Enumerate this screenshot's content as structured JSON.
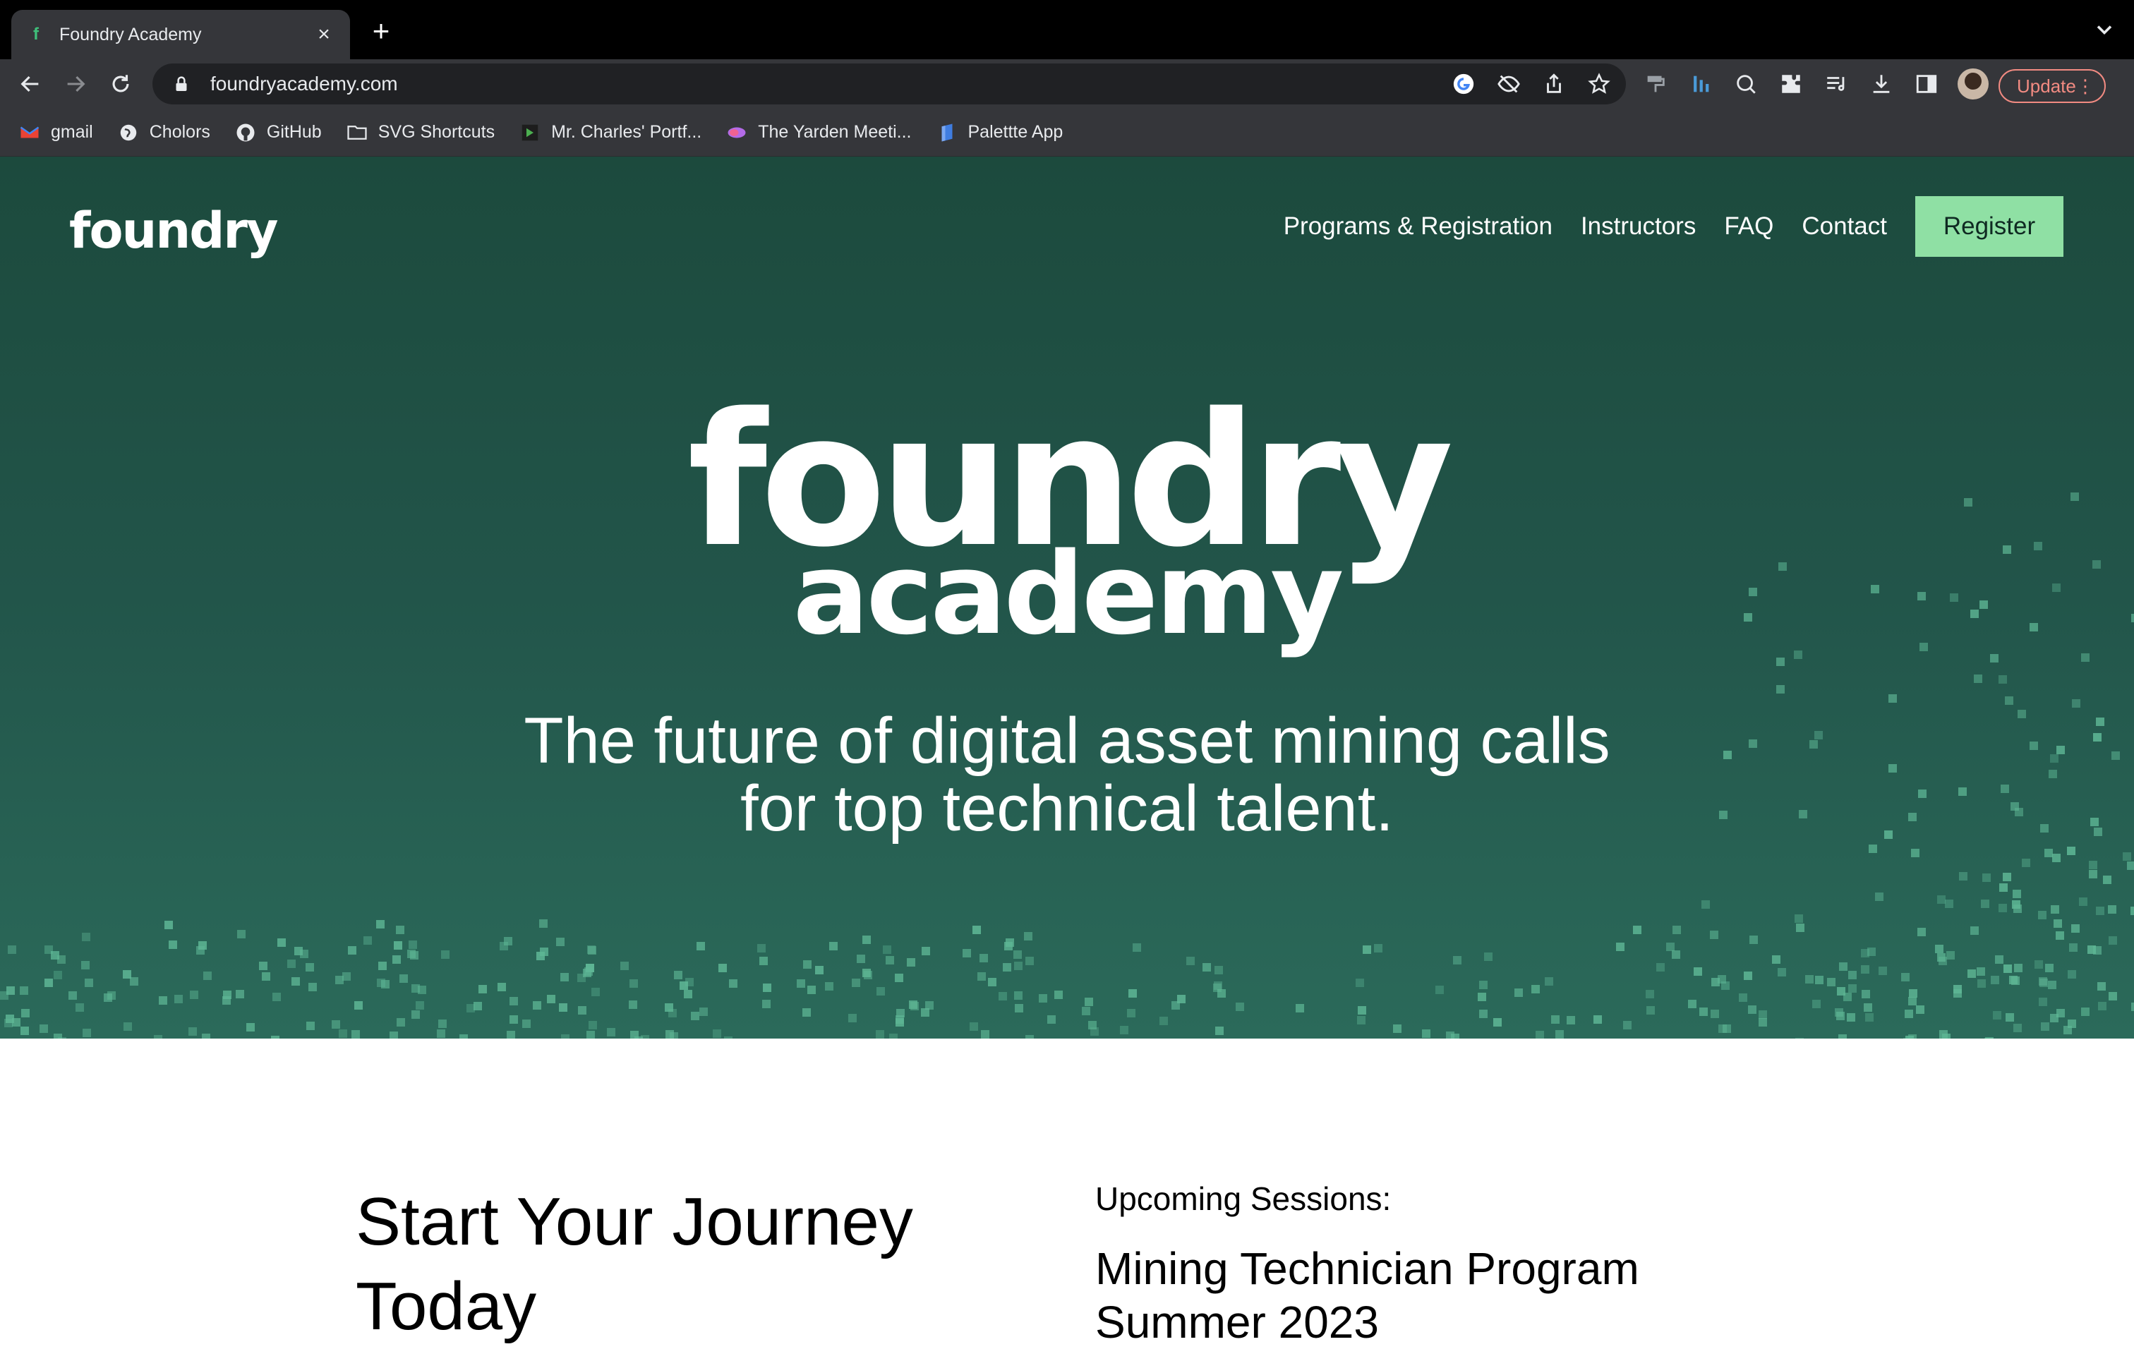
{
  "browser": {
    "tab": {
      "title": "Foundry Academy",
      "favicon": "f"
    },
    "address": {
      "url": "foundryacademy.com"
    },
    "update_label": "Update",
    "bookmarks": [
      {
        "label": "gmail",
        "icon": "gmail-icon"
      },
      {
        "label": "Cholors",
        "icon": "globe-icon"
      },
      {
        "label": "GitHub",
        "icon": "github-icon"
      },
      {
        "label": "SVG Shortcuts",
        "icon": "folder-icon"
      },
      {
        "label": "Mr. Charles' Portf...",
        "icon": "portfolio-icon"
      },
      {
        "label": "The Yarden Meeti...",
        "icon": "meeting-icon"
      },
      {
        "label": "Palettte App",
        "icon": "palette-icon"
      }
    ]
  },
  "site": {
    "nav": {
      "logo": "foundry",
      "links": [
        "Programs & Registration",
        "Instructors",
        "FAQ",
        "Contact"
      ],
      "register_label": "Register"
    },
    "hero": {
      "logo_main": "foundry",
      "logo_sub": "academy",
      "tagline_line1": "The future of digital asset mining calls",
      "tagline_line2": "for top technical talent."
    },
    "journey": {
      "title": "Start Your Journey Today"
    },
    "sessions": {
      "label": "Upcoming Sessions:",
      "program_title": "Mining Technician Program Summer 2023"
    }
  },
  "colors": {
    "hero_bg": "#1c4a3d",
    "register_bg": "#8fe0a4",
    "particle": "#5fb896",
    "update_accent": "#f28b82"
  }
}
